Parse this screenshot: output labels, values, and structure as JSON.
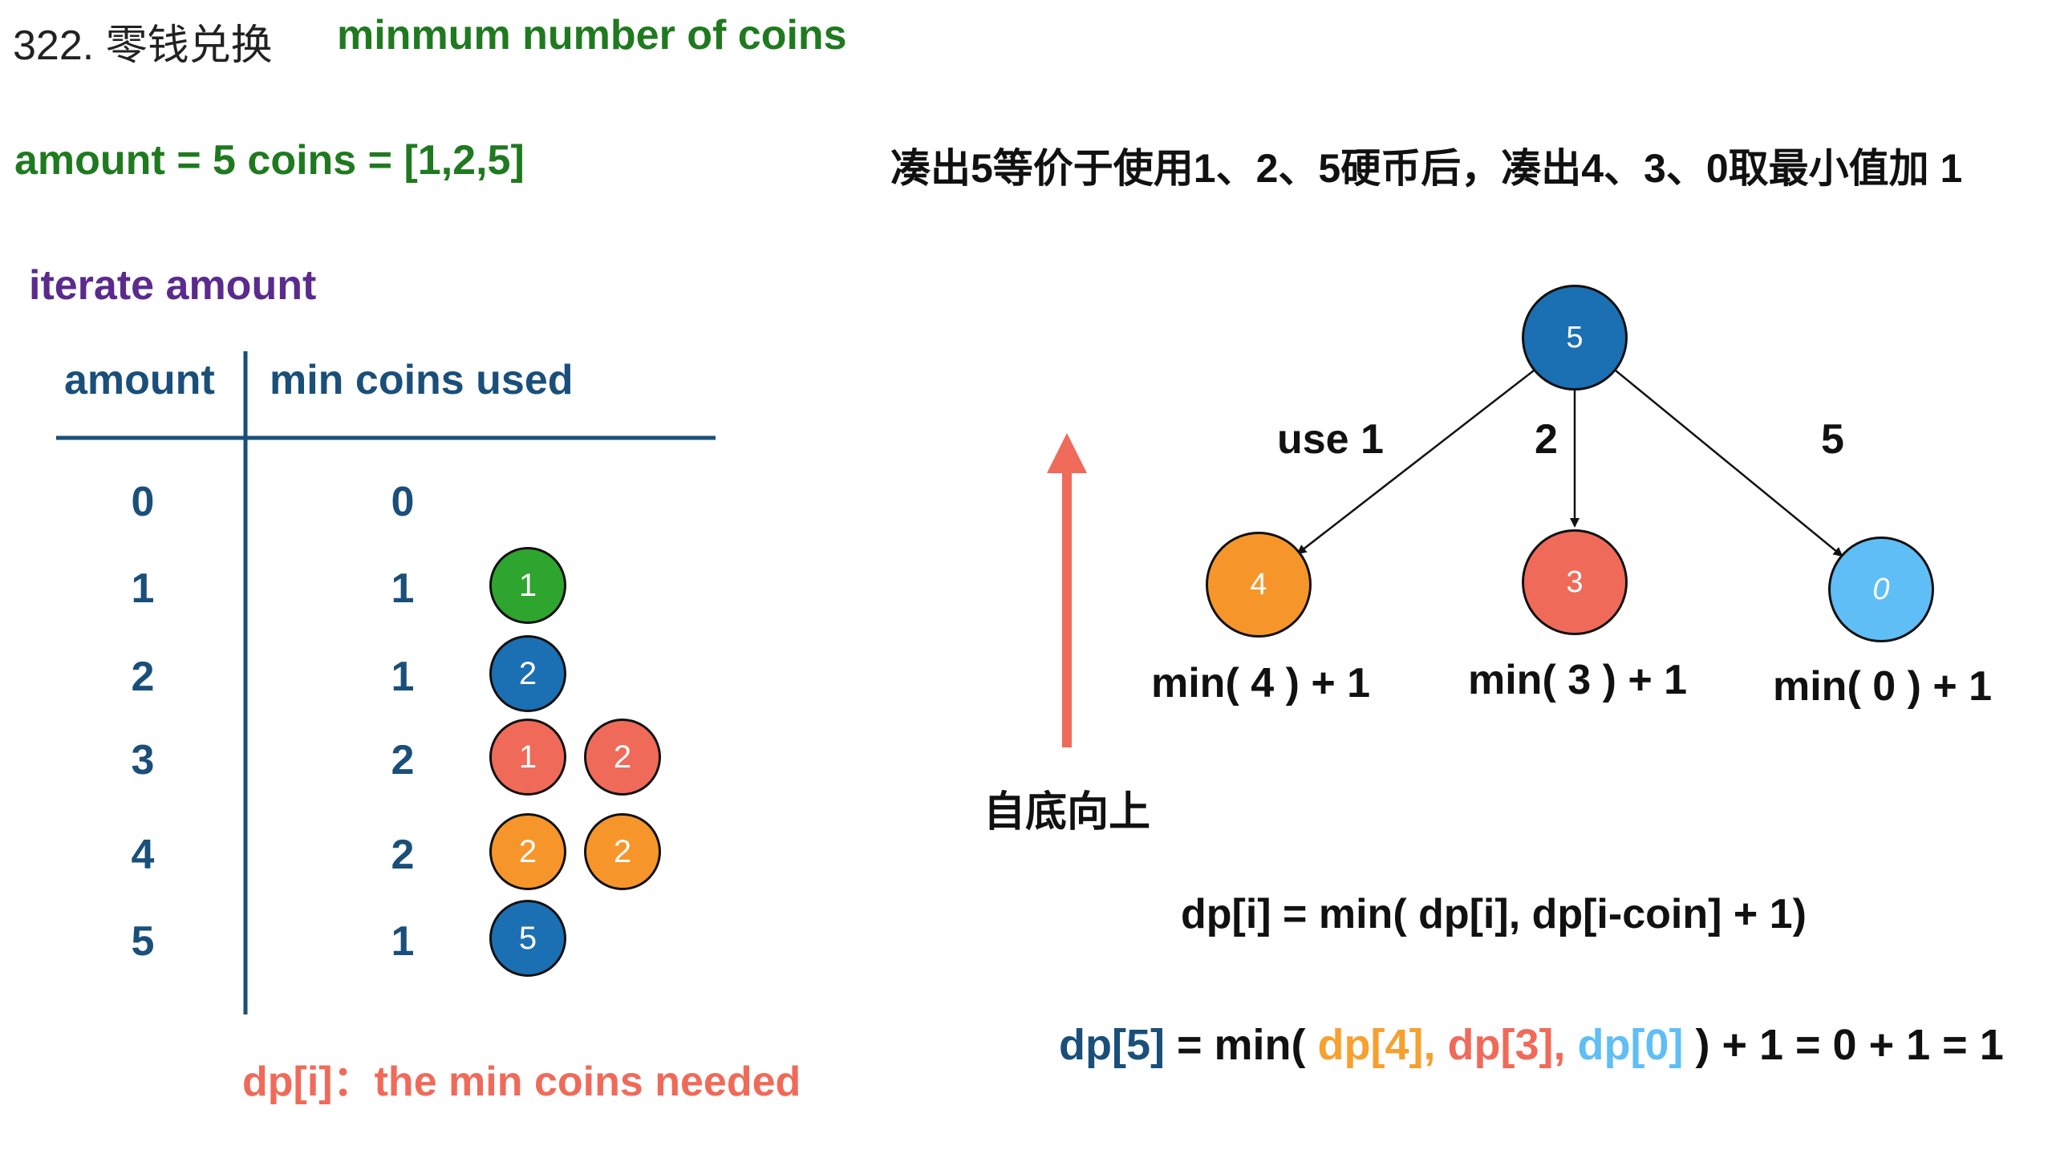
{
  "header": {
    "title_cn": "322. 零钱兑换",
    "title_en": "minmum number of coins",
    "amount_line": "amount = 5  coins = [1,2,5]",
    "explanation": "凑出5等价于使用1、2、5硬币后，凑出4、3、0取最小值加 1"
  },
  "table": {
    "caption": "iterate amount",
    "col_amount": "amount",
    "col_min": "min coins used",
    "rows": [
      {
        "amount": "0",
        "min": "0",
        "coins": []
      },
      {
        "amount": "1",
        "min": "1",
        "coins": [
          {
            "label": "1",
            "color": "#2ea52e"
          }
        ]
      },
      {
        "amount": "2",
        "min": "1",
        "coins": [
          {
            "label": "2",
            "color": "#1b6fb3"
          }
        ]
      },
      {
        "amount": "3",
        "min": "2",
        "coins": [
          {
            "label": "1",
            "color": "#f06a5a"
          },
          {
            "label": "2",
            "color": "#f06a5a"
          }
        ]
      },
      {
        "amount": "4",
        "min": "2",
        "coins": [
          {
            "label": "2",
            "color": "#f6962a"
          },
          {
            "label": "2",
            "color": "#f6962a"
          }
        ]
      },
      {
        "amount": "5",
        "min": "1",
        "coins": [
          {
            "label": "5",
            "color": "#1b6fb3"
          }
        ]
      }
    ],
    "dp_definition": "dp[i]：the min coins needed"
  },
  "tree": {
    "root": {
      "label": "5",
      "color": "#1b6fb3"
    },
    "children": [
      {
        "label": "4",
        "color": "#f6962a",
        "edge_label": "use 1",
        "min_label": "min( 4 ) + 1"
      },
      {
        "label": "3",
        "color": "#f06a5a",
        "edge_label": "2",
        "min_label": "min( 3 ) + 1"
      },
      {
        "label": "0",
        "color": "#5fbef5",
        "edge_label": "5",
        "min_label": "min( 0 ) + 1"
      }
    ],
    "bottom_up_label": "自底向上",
    "arrow_color": "#f06a5a"
  },
  "formulas": {
    "recurrence": "dp[i] = min( dp[i],  dp[i-coin] + 1)",
    "f2_dp5": "dp[5]",
    "f2_eq_min": " = min( ",
    "f2_dp4": "dp[4],",
    "f2_dp3": " dp[3],",
    "f2_dp0": " dp[0]",
    "f2_tail": " ) + 1 = 0 + 1 = 1"
  }
}
